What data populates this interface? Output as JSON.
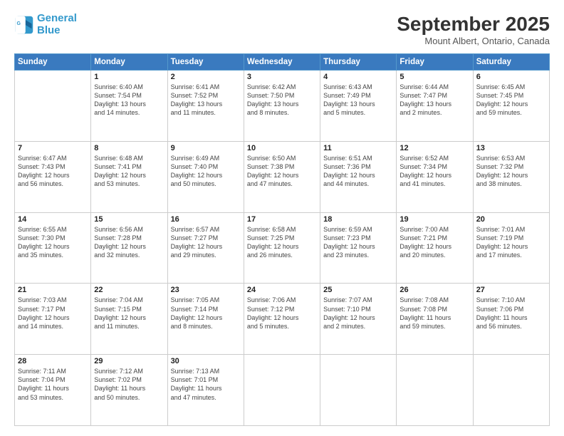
{
  "header": {
    "logo_line1": "General",
    "logo_line2": "Blue",
    "title": "September 2025",
    "subtitle": "Mount Albert, Ontario, Canada"
  },
  "days_of_week": [
    "Sunday",
    "Monday",
    "Tuesday",
    "Wednesday",
    "Thursday",
    "Friday",
    "Saturday"
  ],
  "weeks": [
    [
      {
        "day": "",
        "content": ""
      },
      {
        "day": "1",
        "content": "Sunrise: 6:40 AM\nSunset: 7:54 PM\nDaylight: 13 hours\nand 14 minutes."
      },
      {
        "day": "2",
        "content": "Sunrise: 6:41 AM\nSunset: 7:52 PM\nDaylight: 13 hours\nand 11 minutes."
      },
      {
        "day": "3",
        "content": "Sunrise: 6:42 AM\nSunset: 7:50 PM\nDaylight: 13 hours\nand 8 minutes."
      },
      {
        "day": "4",
        "content": "Sunrise: 6:43 AM\nSunset: 7:49 PM\nDaylight: 13 hours\nand 5 minutes."
      },
      {
        "day": "5",
        "content": "Sunrise: 6:44 AM\nSunset: 7:47 PM\nDaylight: 13 hours\nand 2 minutes."
      },
      {
        "day": "6",
        "content": "Sunrise: 6:45 AM\nSunset: 7:45 PM\nDaylight: 12 hours\nand 59 minutes."
      }
    ],
    [
      {
        "day": "7",
        "content": "Sunrise: 6:47 AM\nSunset: 7:43 PM\nDaylight: 12 hours\nand 56 minutes."
      },
      {
        "day": "8",
        "content": "Sunrise: 6:48 AM\nSunset: 7:41 PM\nDaylight: 12 hours\nand 53 minutes."
      },
      {
        "day": "9",
        "content": "Sunrise: 6:49 AM\nSunset: 7:40 PM\nDaylight: 12 hours\nand 50 minutes."
      },
      {
        "day": "10",
        "content": "Sunrise: 6:50 AM\nSunset: 7:38 PM\nDaylight: 12 hours\nand 47 minutes."
      },
      {
        "day": "11",
        "content": "Sunrise: 6:51 AM\nSunset: 7:36 PM\nDaylight: 12 hours\nand 44 minutes."
      },
      {
        "day": "12",
        "content": "Sunrise: 6:52 AM\nSunset: 7:34 PM\nDaylight: 12 hours\nand 41 minutes."
      },
      {
        "day": "13",
        "content": "Sunrise: 6:53 AM\nSunset: 7:32 PM\nDaylight: 12 hours\nand 38 minutes."
      }
    ],
    [
      {
        "day": "14",
        "content": "Sunrise: 6:55 AM\nSunset: 7:30 PM\nDaylight: 12 hours\nand 35 minutes."
      },
      {
        "day": "15",
        "content": "Sunrise: 6:56 AM\nSunset: 7:28 PM\nDaylight: 12 hours\nand 32 minutes."
      },
      {
        "day": "16",
        "content": "Sunrise: 6:57 AM\nSunset: 7:27 PM\nDaylight: 12 hours\nand 29 minutes."
      },
      {
        "day": "17",
        "content": "Sunrise: 6:58 AM\nSunset: 7:25 PM\nDaylight: 12 hours\nand 26 minutes."
      },
      {
        "day": "18",
        "content": "Sunrise: 6:59 AM\nSunset: 7:23 PM\nDaylight: 12 hours\nand 23 minutes."
      },
      {
        "day": "19",
        "content": "Sunrise: 7:00 AM\nSunset: 7:21 PM\nDaylight: 12 hours\nand 20 minutes."
      },
      {
        "day": "20",
        "content": "Sunrise: 7:01 AM\nSunset: 7:19 PM\nDaylight: 12 hours\nand 17 minutes."
      }
    ],
    [
      {
        "day": "21",
        "content": "Sunrise: 7:03 AM\nSunset: 7:17 PM\nDaylight: 12 hours\nand 14 minutes."
      },
      {
        "day": "22",
        "content": "Sunrise: 7:04 AM\nSunset: 7:15 PM\nDaylight: 12 hours\nand 11 minutes."
      },
      {
        "day": "23",
        "content": "Sunrise: 7:05 AM\nSunset: 7:14 PM\nDaylight: 12 hours\nand 8 minutes."
      },
      {
        "day": "24",
        "content": "Sunrise: 7:06 AM\nSunset: 7:12 PM\nDaylight: 12 hours\nand 5 minutes."
      },
      {
        "day": "25",
        "content": "Sunrise: 7:07 AM\nSunset: 7:10 PM\nDaylight: 12 hours\nand 2 minutes."
      },
      {
        "day": "26",
        "content": "Sunrise: 7:08 AM\nSunset: 7:08 PM\nDaylight: 11 hours\nand 59 minutes."
      },
      {
        "day": "27",
        "content": "Sunrise: 7:10 AM\nSunset: 7:06 PM\nDaylight: 11 hours\nand 56 minutes."
      }
    ],
    [
      {
        "day": "28",
        "content": "Sunrise: 7:11 AM\nSunset: 7:04 PM\nDaylight: 11 hours\nand 53 minutes."
      },
      {
        "day": "29",
        "content": "Sunrise: 7:12 AM\nSunset: 7:02 PM\nDaylight: 11 hours\nand 50 minutes."
      },
      {
        "day": "30",
        "content": "Sunrise: 7:13 AM\nSunset: 7:01 PM\nDaylight: 11 hours\nand 47 minutes."
      },
      {
        "day": "",
        "content": ""
      },
      {
        "day": "",
        "content": ""
      },
      {
        "day": "",
        "content": ""
      },
      {
        "day": "",
        "content": ""
      }
    ]
  ]
}
